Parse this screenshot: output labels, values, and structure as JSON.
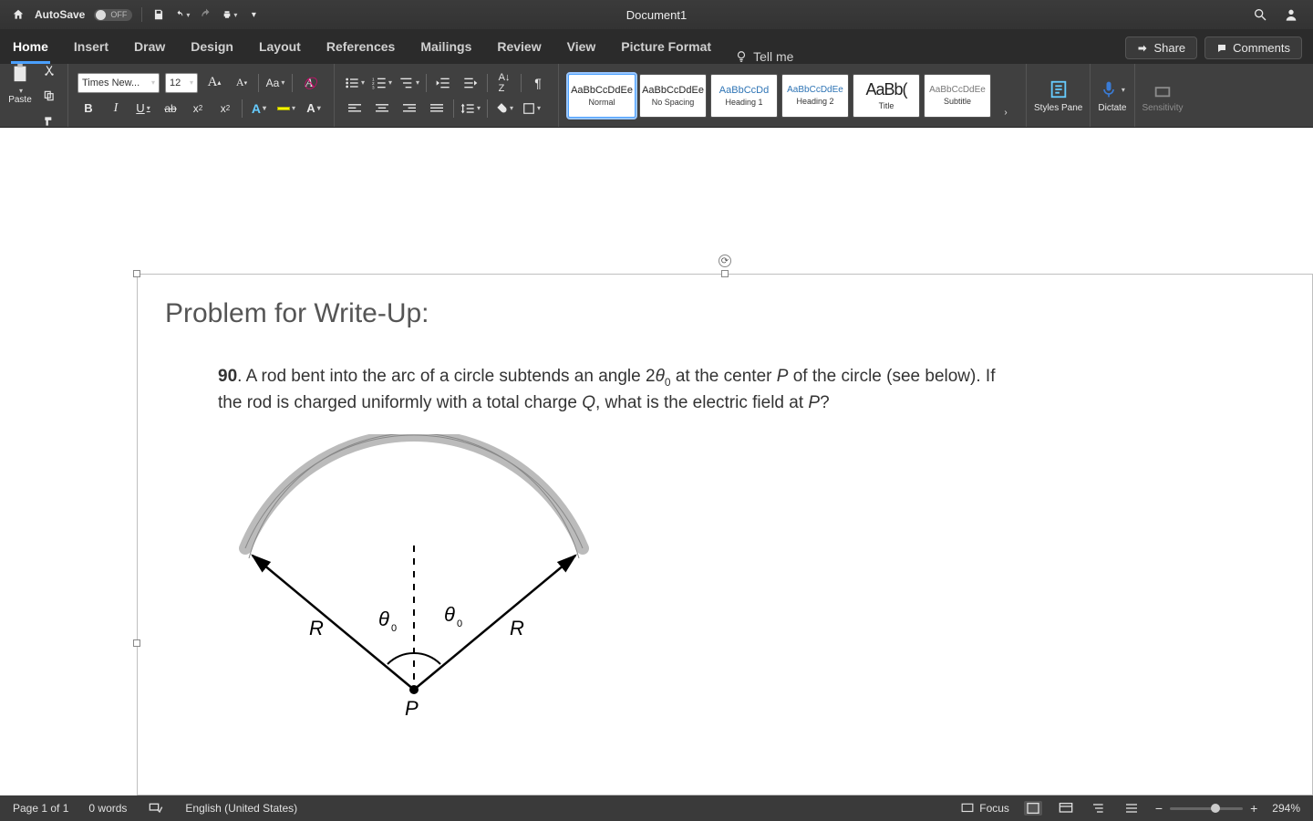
{
  "titlebar": {
    "autosave_label": "AutoSave",
    "autosave_state": "OFF",
    "doc_title": "Document1"
  },
  "tabs": {
    "items": [
      "Home",
      "Insert",
      "Draw",
      "Design",
      "Layout",
      "References",
      "Mailings",
      "Review",
      "View",
      "Picture Format"
    ],
    "active_index": 0,
    "tell_me": "Tell me",
    "share": "Share",
    "comments": "Comments"
  },
  "ribbon": {
    "paste": "Paste",
    "font_name": "Times New...",
    "font_size": "12",
    "styles": [
      {
        "sample": "AaBbCcDdEe",
        "label": "Normal",
        "cls": "selected"
      },
      {
        "sample": "AaBbCcDdEe",
        "label": "No Spacing",
        "cls": ""
      },
      {
        "sample": "AaBbCcDd",
        "label": "Heading 1",
        "cls": "h1"
      },
      {
        "sample": "AaBbCcDdEe",
        "label": "Heading 2",
        "cls": "h2"
      },
      {
        "sample": "AaBb(",
        "label": "Title",
        "cls": "title"
      },
      {
        "sample": "AaBbCcDdEe",
        "label": "Subtitle",
        "cls": "subtitle"
      }
    ],
    "styles_pane": "Styles Pane",
    "dictate": "Dictate",
    "sensitivity": "Sensitivity"
  },
  "document": {
    "heading": "Problem for Write-Up:",
    "problem_num": "90",
    "problem_lead": ". A rod bent into the arc of a circle subtends an angle 2",
    "problem_theta": "θ",
    "problem_sub0a": "0",
    "problem_mid": " at the center ",
    "problem_P1": "P",
    "problem_mid2": " of the circle (see below). If the rod is charged uniformly with a total charge ",
    "problem_Q": "Q",
    "problem_mid3": ", what is the electric field at ",
    "problem_P2": "P",
    "problem_end": "?",
    "figure": {
      "R_left": "R",
      "R_right": "R",
      "theta_left": "θ",
      "theta_sub_left": "0",
      "theta_right": "θ",
      "theta_sub_right": "0",
      "P": "P"
    }
  },
  "statusbar": {
    "page": "Page 1 of 1",
    "words": "0 words",
    "lang": "English (United States)",
    "focus": "Focus",
    "zoom": "294%"
  }
}
